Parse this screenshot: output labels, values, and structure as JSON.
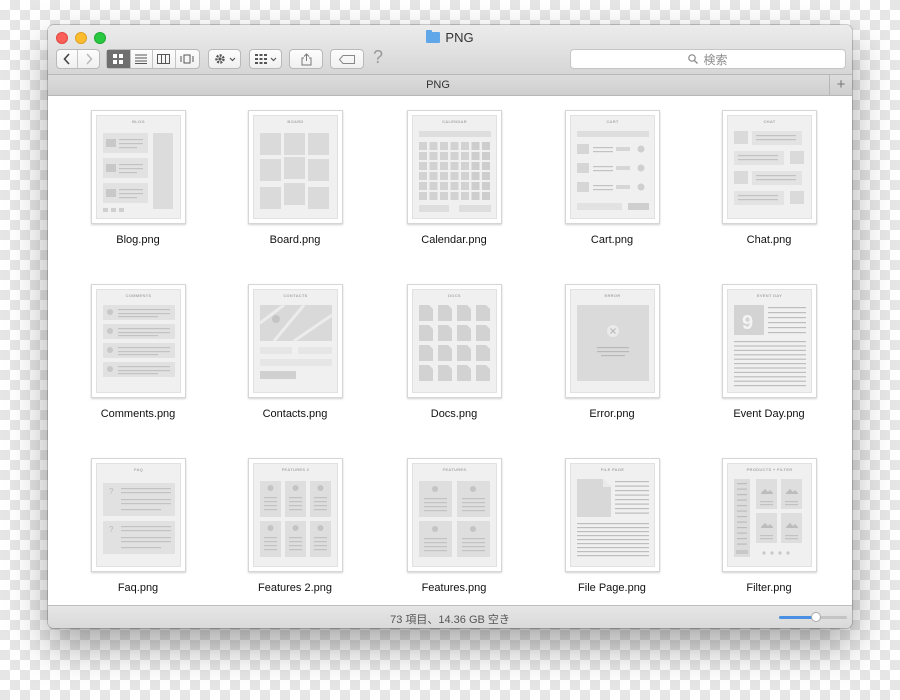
{
  "window": {
    "title": "PNG"
  },
  "toolbar": {
    "back_icon": "chevron-left-icon",
    "forward_icon": "chevron-right-icon",
    "view_modes": [
      "icon-view",
      "list-view",
      "column-view",
      "cover-flow-view"
    ],
    "active_view": "icon-view",
    "help_label": "?"
  },
  "search": {
    "placeholder": "検索"
  },
  "tab": {
    "label": "PNG",
    "add_label": "+"
  },
  "files": [
    {
      "name": "Blog.png",
      "thumb_title": "BLOG",
      "kind": "blog"
    },
    {
      "name": "Board.png",
      "thumb_title": "BOARD",
      "kind": "board"
    },
    {
      "name": "Calendar.png",
      "thumb_title": "CALENDAR",
      "kind": "calendar"
    },
    {
      "name": "Cart.png",
      "thumb_title": "CART",
      "kind": "cart"
    },
    {
      "name": "Chat.png",
      "thumb_title": "CHAT",
      "kind": "chat"
    },
    {
      "name": "Comments.png",
      "thumb_title": "COMMENTS",
      "kind": "comments"
    },
    {
      "name": "Contacts.png",
      "thumb_title": "CONTACTS",
      "kind": "contacts"
    },
    {
      "name": "Docs.png",
      "thumb_title": "DOCS",
      "kind": "docs"
    },
    {
      "name": "Error.png",
      "thumb_title": "ERROR",
      "kind": "error"
    },
    {
      "name": "Event Day.png",
      "thumb_title": "EVENT DAY",
      "kind": "event"
    },
    {
      "name": "Faq.png",
      "thumb_title": "FAQ",
      "kind": "faq"
    },
    {
      "name": "Features 2.png",
      "thumb_title": "FEATURES 2",
      "kind": "features2"
    },
    {
      "name": "Features.png",
      "thumb_title": "FEATURES",
      "kind": "features"
    },
    {
      "name": "File Page.png",
      "thumb_title": "FILE PAGE",
      "kind": "filepage"
    },
    {
      "name": "Filter.png",
      "thumb_title": "PRODUCTS + FILTER",
      "kind": "filter"
    }
  ],
  "status": {
    "text": "73 項目、14.36 GB 空き",
    "zoom_level": 0.55
  },
  "colors": {
    "accent": "#4a90e2",
    "close": "#fc5f57",
    "minimize": "#fdbc2e",
    "maximize": "#28c840"
  }
}
